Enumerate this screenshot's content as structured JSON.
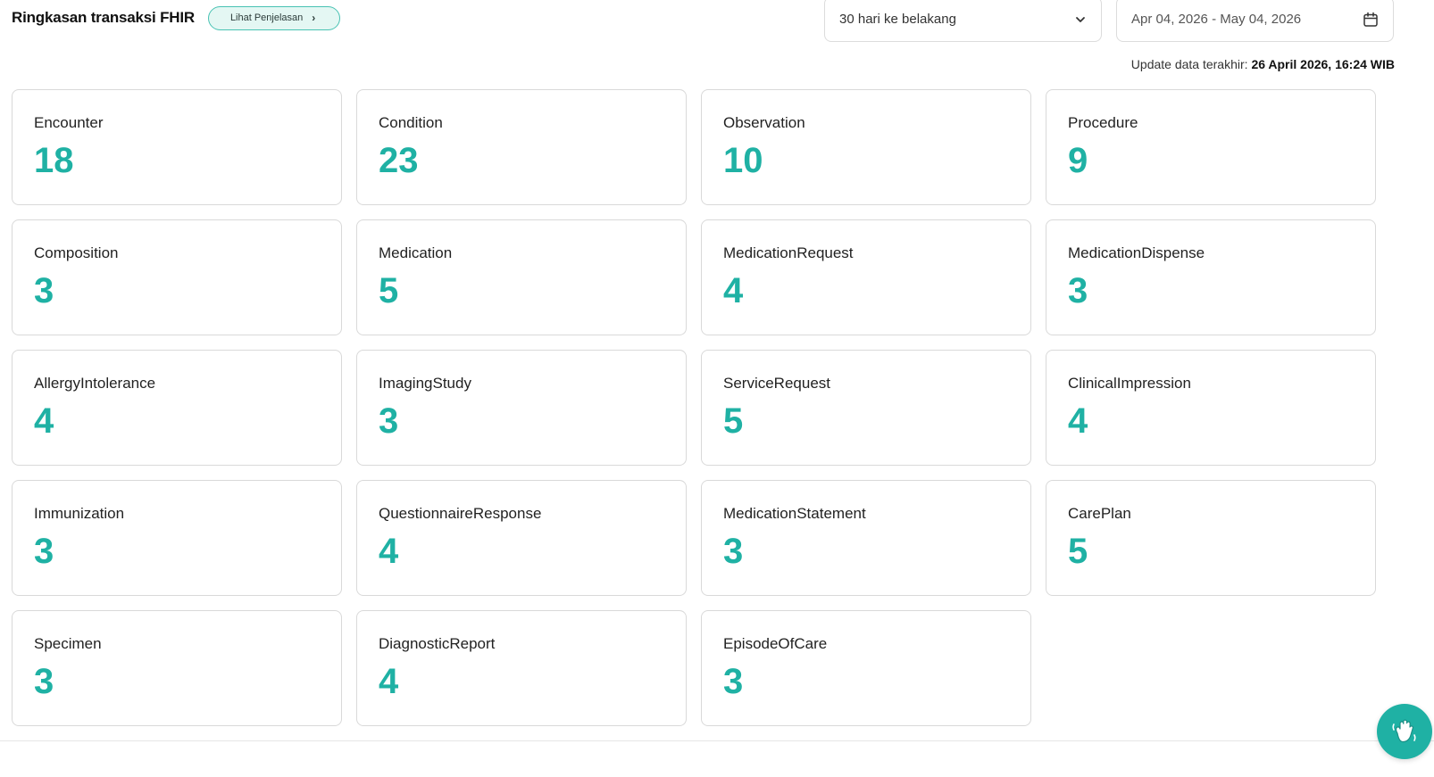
{
  "header": {
    "title": "Ringkasan transaksi FHIR",
    "explain_label": "Lihat Penjelasan"
  },
  "filters": {
    "range_value": "30 hari ke belakang",
    "date_range": "Apr 04, 2026 - May 04, 2026"
  },
  "update": {
    "label": "Update data terakhir: ",
    "value": "26 April 2026, 16:24 WIB"
  },
  "cards": [
    {
      "label": "Encounter",
      "value": "18"
    },
    {
      "label": "Condition",
      "value": "23"
    },
    {
      "label": "Observation",
      "value": "10"
    },
    {
      "label": "Procedure",
      "value": "9"
    },
    {
      "label": "Composition",
      "value": "3"
    },
    {
      "label": "Medication",
      "value": "5"
    },
    {
      "label": "MedicationRequest",
      "value": "4"
    },
    {
      "label": "MedicationDispense",
      "value": "3"
    },
    {
      "label": "AllergyIntolerance",
      "value": "4"
    },
    {
      "label": "ImagingStudy",
      "value": "3"
    },
    {
      "label": "ServiceRequest",
      "value": "5"
    },
    {
      "label": "ClinicalImpression",
      "value": "4"
    },
    {
      "label": "Immunization",
      "value": "3"
    },
    {
      "label": "QuestionnaireResponse",
      "value": "4"
    },
    {
      "label": "MedicationStatement",
      "value": "3"
    },
    {
      "label": "CarePlan",
      "value": "5"
    },
    {
      "label": "Specimen",
      "value": "3"
    },
    {
      "label": "DiagnosticReport",
      "value": "4"
    },
    {
      "label": "EpisodeOfCare",
      "value": "3"
    }
  ],
  "colors": {
    "accent": "#1fb1a4",
    "badge_bg": "#e4f7f3"
  },
  "icons": {
    "explain": "chevron-right-icon",
    "range": "chevron-down-icon",
    "date": "calendar-icon",
    "help": "waving-hand-icon"
  }
}
